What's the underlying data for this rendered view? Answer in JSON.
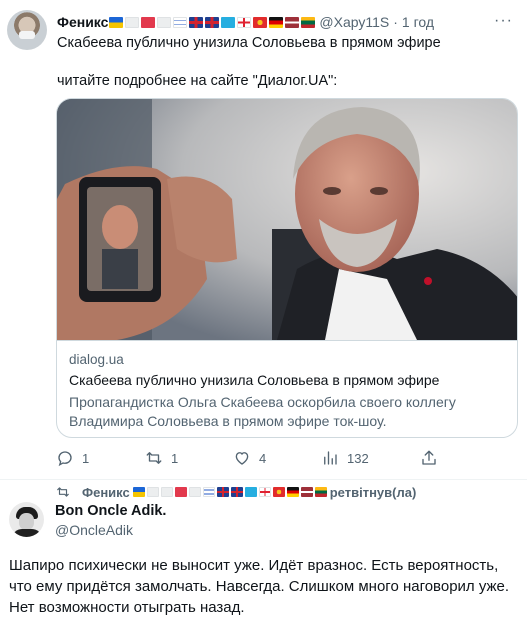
{
  "tweet": {
    "author_name": "Феникс",
    "author_flags": [
      "ua",
      "white",
      "red",
      "white",
      "il",
      "gb",
      "gb",
      "kz",
      "ge",
      "kg",
      "de",
      "lv",
      "lt"
    ],
    "author_handle": "@Хару11S",
    "separator": "·",
    "time": "1 год",
    "more": "···",
    "text_line1": "Скабеева публично унизила Соловьева в прямом эфире",
    "text_line2": "читайте подробнее на сайте \"Диалог.UA\":",
    "card": {
      "domain": "dialog.ua",
      "title": "Скабеева публично унизила Соловьева в прямом эфире",
      "description": "Пропагандистка Ольга Скабеева оскорбила своего коллегу Владимира Соловьева в прямом эфире ток-шоу."
    },
    "actions": {
      "reply_count": "1",
      "retweet_count": "1",
      "like_count": "4",
      "views_count": "132"
    }
  },
  "retweet_bar": {
    "name": "Феникс",
    "flags": [
      "ua",
      "white",
      "white",
      "red",
      "white",
      "il",
      "gb",
      "gb",
      "kz",
      "ge",
      "kg",
      "de",
      "lv",
      "lt"
    ],
    "suffix": "ретвітнув(ла)"
  },
  "reply": {
    "author_name": "Bon Oncle Adik.",
    "author_handle": "@OncleAdik",
    "text": "Шапиро психически не выносит уже. Идёт вразнос. Есть вероятность, что ему придётся замолчать. Навсегда. Слишком много наговорил уже. Нет возможности отыграть назад."
  }
}
